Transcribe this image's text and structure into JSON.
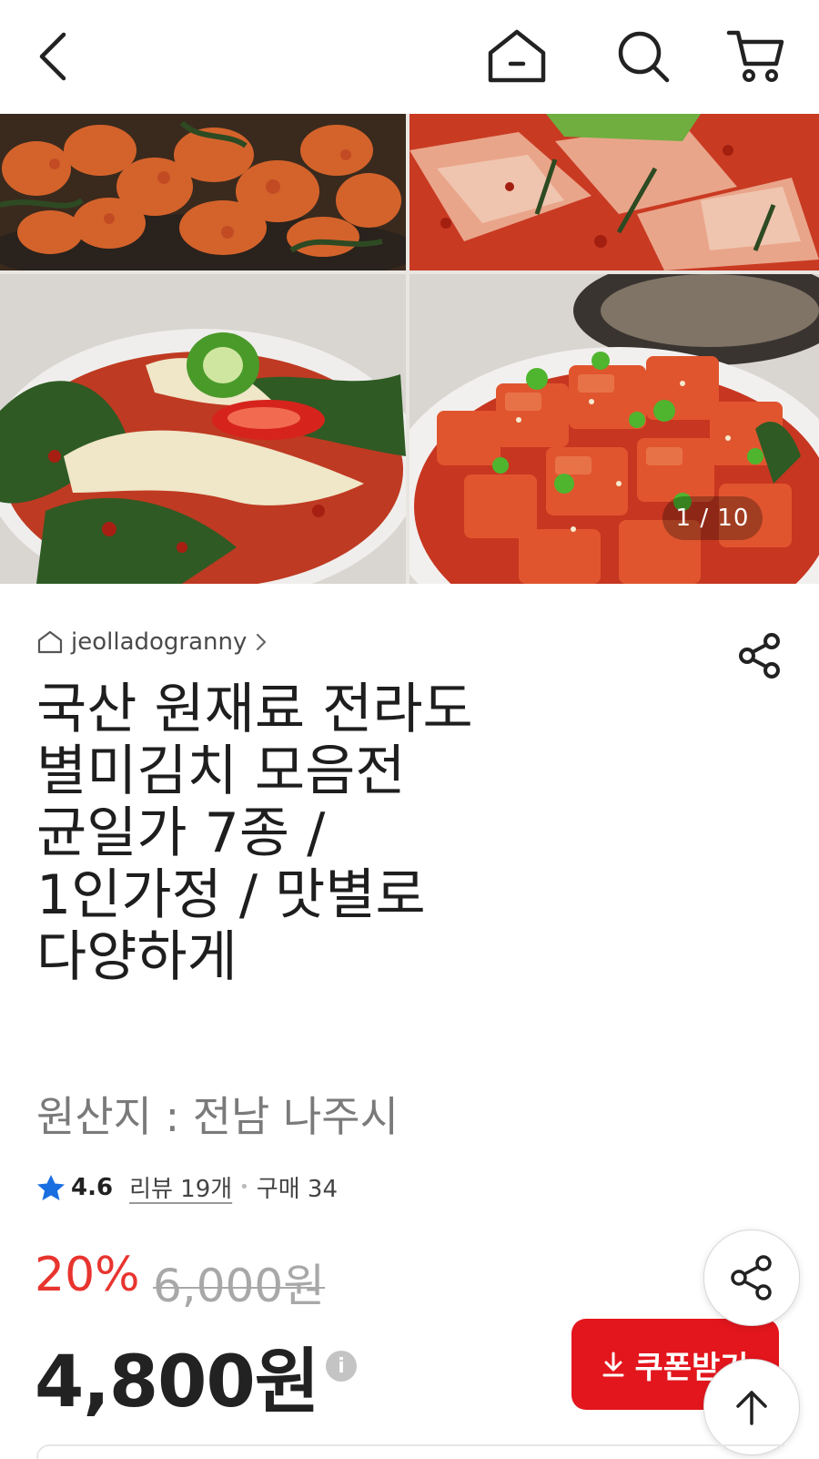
{
  "header": {
    "back_icon": "back-arrow-icon",
    "home_icon": "home-icon",
    "search_icon": "search-icon",
    "cart_icon": "cart-icon"
  },
  "gallery": {
    "counter": "1 / 10",
    "images": [
      "kimchi-radish-cubes",
      "kimchi-cabbage-wide",
      "kimchi-young-cabbage-with-peppers",
      "kkakdugi-radish-cubes"
    ]
  },
  "product": {
    "store_name": "jeolladogranny",
    "title": "국산 원재료 전라도\n별미김치 모음전\n균일가 7종 /\n1인가정 / 맛별로\n다양하게",
    "origin": "원산지 : 전남 나주시",
    "rating": "4.6",
    "review_label": "리뷰 19개",
    "purchase_label": "구매 34",
    "discount": "20%",
    "original_price": "6,000원",
    "price": "4,800원",
    "coupon_label": "쿠폰받기"
  },
  "colors": {
    "accent_red": "#e3161d",
    "discount_red": "#e8342f",
    "star_blue": "#1a6fe0"
  }
}
